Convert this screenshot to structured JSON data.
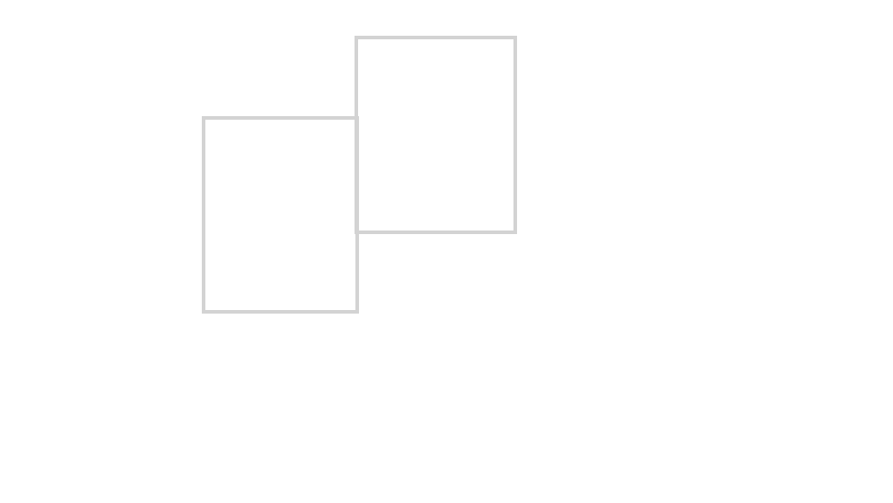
{
  "shapes": [
    {
      "name": "rectangle-left",
      "stroke": "#d3d3d3",
      "fill": "#ffffff"
    },
    {
      "name": "rectangle-right",
      "stroke": "#d3d3d3",
      "fill": "#ffffff"
    }
  ],
  "background": "#ffffff"
}
